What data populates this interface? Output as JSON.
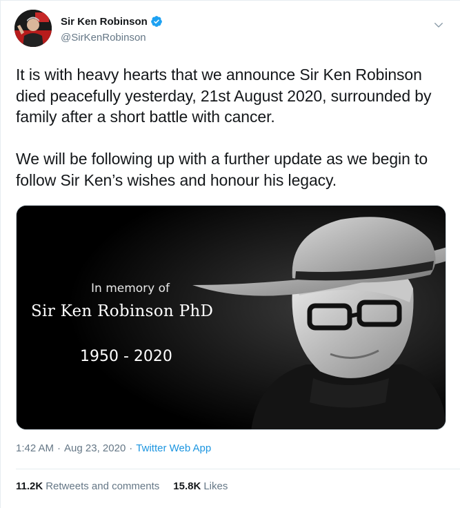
{
  "author": {
    "display_name": "Sir Ken Robinson",
    "handle": "@SirKenRobinson",
    "verified": true
  },
  "tweet": {
    "text": "It is with heavy hearts that we announce Sir Ken Robinson died peacefully yesterday, 21st August 2020, surrounded by family after a short battle with cancer.\n\nWe will be following up with a further update as we begin to follow Sir Ken’s wishes and honour his legacy.",
    "time": "1:42 AM",
    "date": "Aug 23, 2020",
    "source": "Twitter Web App",
    "separator": "·"
  },
  "media": {
    "intro": "In memory of",
    "name": "Sir Ken Robinson PhD",
    "years": "1950 - 2020"
  },
  "stats": {
    "retweets_count": "11.2K",
    "retweets_label": "Retweets and comments",
    "likes_count": "15.8K",
    "likes_label": "Likes"
  },
  "colors": {
    "verified": "#1da1f2",
    "link": "#1b95e0",
    "secondary_text": "#657786"
  },
  "icons": {
    "verified": "verified-badge-icon",
    "caret": "chevron-down-icon"
  }
}
